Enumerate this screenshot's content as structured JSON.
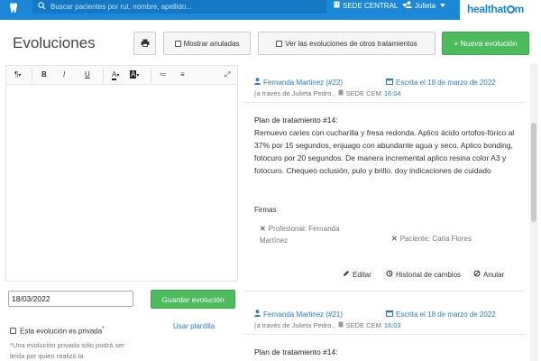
{
  "topbar": {
    "search_placeholder": "Buscar pacientes por rut, nombre, apellido...",
    "sede": "SEDE CENTRAL",
    "user": "Julieta",
    "logo": "healthatom"
  },
  "header": {
    "title": "Evoluciones",
    "anuladas_label": "Mostrar anuladas",
    "otros_label": "Ver las evoluciones de otros tratamientos",
    "nueva_label": "+ Nueva evolución"
  },
  "editor": {
    "toolbar": [
      "¶",
      "B",
      "I",
      "U",
      "A",
      "A",
      "≔",
      "≡",
      "⤢"
    ],
    "date_value": "18/03/2022",
    "save_label": "Guardar evolución",
    "private_label": "Esta evolución es privada",
    "private_mark": "*",
    "plantilla_label": "Usar plantilla",
    "private_note": "*Una evolución privada sólo podrá ser leída por quien realizó la"
  },
  "evoluciones": [
    {
      "author": "Fernanda Martinez (#22)",
      "written": "Escrita el 18 de marzo de 2022",
      "via": "(a través de Julieta Pedro ,",
      "sede": "SEDE CEM",
      "time": "16:04",
      "plan_title": "Plan de tratamiento #14:",
      "plan_text": "Remuevo caries con cucharilla y fresa redonda. Aplico ácido ortofos-fórico al 37% por 15 segundos, enjuago con abundante agua y seco. Aplico bonding, fotocuro por 20 segundos. De manera incremental aplico resina color A3 y fotocuro. Chequeo oclusión, pulo y brillo. doy indicaciones de cuidado",
      "firmas_label": "Firmas",
      "sig_profesional": "Profesional: Fernanda Martínez",
      "sig_paciente": "Paciente: Carla Flores",
      "actions": [
        "Editar",
        "Historial de cambios",
        "Anular"
      ]
    },
    {
      "author": "Fernanda Martinez (#21)",
      "written": "Escrita el 18 de marzo de 2022",
      "via": "(a través de Julieta Pedro ,",
      "sede": "SEDE CEM",
      "time": "16:03",
      "plan_title": "Plan de tratamiento #14:"
    }
  ],
  "colors": {
    "brand_blue": "#1c87d6",
    "green": "#4cbb5c",
    "link_blue": "#2a7cc7"
  }
}
